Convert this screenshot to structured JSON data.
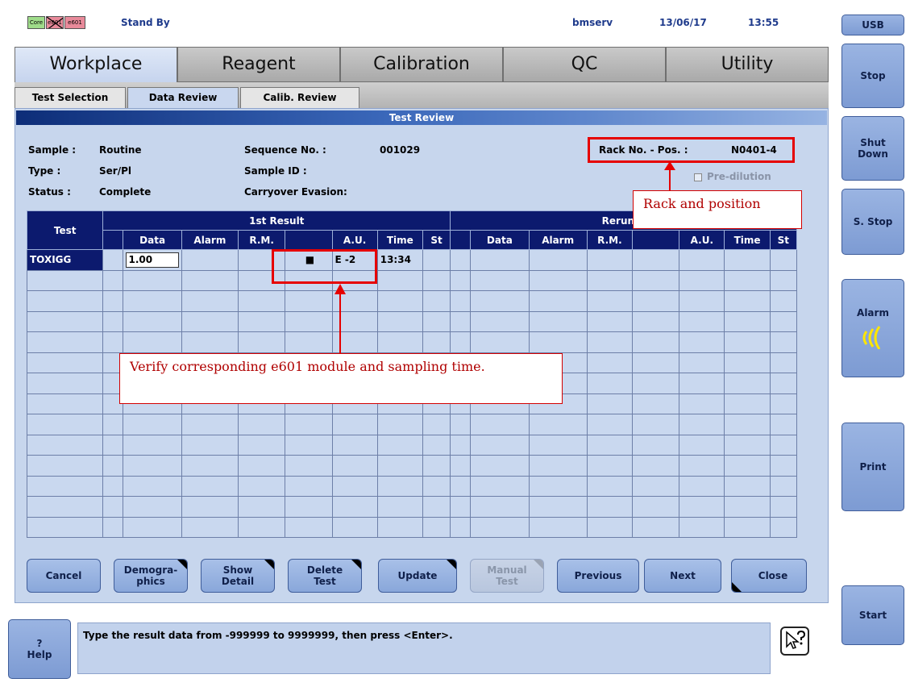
{
  "status": {
    "modules": [
      "Core",
      "e801",
      "e601"
    ],
    "state": "Stand By",
    "user": "bmserv",
    "date": "13/06/17",
    "time": "13:55"
  },
  "side_buttons": [
    "USB",
    "Stop",
    "Shut Down",
    "S. Stop",
    "Alarm",
    "Print",
    "Start"
  ],
  "main_tabs": [
    "Workplace",
    "Reagent",
    "Calibration",
    "QC",
    "Utility"
  ],
  "sub_tabs": [
    "Test Selection",
    "Data Review",
    "Calib. Review"
  ],
  "panel_title": "Test Review",
  "info": {
    "sample_label": "Sample :",
    "sample_value": "Routine",
    "type_label": "Type :",
    "type_value": "Ser/Pl",
    "status_label": "Status :",
    "status_value": "Complete",
    "seq_label": "Sequence No. :",
    "seq_value": "001029",
    "sample_id_label": "Sample ID :",
    "carryover_label": "Carryover Evasion:",
    "rack_label": "Rack No. - Pos. :",
    "rack_value": "N0401-4",
    "predilution_label": "Pre-dilution"
  },
  "table": {
    "test_header": "Test",
    "first_result_header": "1st Result",
    "rerun_header": "Rerun R",
    "columns": [
      "Data",
      "Alarm",
      "R.M.",
      "",
      "A.U.",
      "Time",
      "St"
    ],
    "row": {
      "test": "TOXIGG",
      "data": "1.00",
      "module_marker": "■",
      "au": "E -2",
      "time": "13:34"
    }
  },
  "bottom_buttons": [
    "Cancel",
    "Demogra-\nphics",
    "Show\nDetail",
    "Delete\nTest",
    "Update",
    "Manual\nTest",
    "Previous",
    "Next",
    "Close"
  ],
  "help": {
    "icon": "?",
    "label": "Help",
    "message": "Type the result data from -999999 to 9999999, then press <Enter>."
  },
  "annotations": {
    "rack_note": "Rack and position",
    "module_note": "Verify corresponding e601 module and sampling time."
  }
}
